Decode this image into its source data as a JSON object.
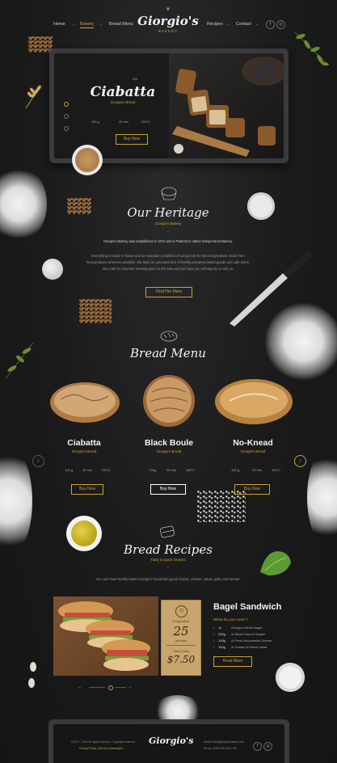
{
  "nav": {
    "items": [
      "Home",
      "Bakery",
      "Bread Menu",
      "Recipes",
      "Contact"
    ],
    "logo": "Giorgio's",
    "logo_sub": "BAKERY",
    "social": [
      "f",
      "◎"
    ]
  },
  "hero": {
    "title": "Ciabatta",
    "subtitle": "Giorgio's Bread",
    "meta": [
      "100 g",
      "30 min",
      "200°C"
    ],
    "button": "Buy Now"
  },
  "heritage": {
    "title": "Our Heritage",
    "subtitle": "Giorgio's Bakery",
    "para1": "Giorgio's Bakery was established in 1972 and is Palermo's oldest Independent Bakery.",
    "para2": "Everything is made in house and we maintain a tradition of using only the finest ingredients made from",
    "para3": "local produce wherever possible. We have an extensive line of freshly prepared baked goods and cafe items.",
    "para4": "Our Cafe is a favorite meeting place in the area and we hope you will stop by to visit us.",
    "button": "Find Her More"
  },
  "menu": {
    "title": "Bread Menu",
    "breads": [
      {
        "name": "Ciabatta",
        "sub": "Giorgio's Bread",
        "meta": [
          "100 g",
          "40 min",
          "220°C"
        ],
        "button": "Buy Now"
      },
      {
        "name": "Black Boule",
        "sub": "Giorgio's Bread",
        "meta": [
          "700g",
          "20 min",
          "180°C"
        ],
        "button": "Buy Now"
      },
      {
        "name": "No-Knead",
        "sub": "Giorgio's Bread",
        "meta": [
          "100 g",
          "30 min",
          "300°C"
        ],
        "button": "Buy Now"
      }
    ]
  },
  "recipes": {
    "title": "Bread Recipes",
    "subtitle": "Tasty & Quick Snacks",
    "intro": "You can't beat freshly baked Giorgio's bread with good cheese, cheese, salad, garlic and tomato.",
    "card": {
      "prep_label": "Preparation",
      "prep_value": "25",
      "prep_unit": "minutes",
      "cost_label": "Total Costs",
      "cost_value": "$7.50"
    },
    "recipe_title": "Bagel Sandwich",
    "need_label": "What do you need ?",
    "ingredients": [
      {
        "qty": "1x",
        "item": "Giorgio's White Bagel"
      },
      {
        "qty": "250g",
        "item": "of Sliced Ham & Salami"
      },
      {
        "qty": "100g",
        "item": "of Fresh Mozzarella Cheese"
      },
      {
        "qty": "150g",
        "item": "of Tomato & Mixed Salad"
      }
    ],
    "button": "Read More"
  },
  "footer": {
    "copyright": "©1972 - 2016 All rights reserved. Copyright reserved.",
    "links": "Privacy Policy  |  Site by Dreamingful",
    "logo": "Giorgio's",
    "email": "Email: hello@giorgiosbakery.com",
    "phone": "Phone: 0039 091 6212 195"
  },
  "colors": {
    "accent": "#c9a233",
    "background": "#1b1b1c"
  }
}
